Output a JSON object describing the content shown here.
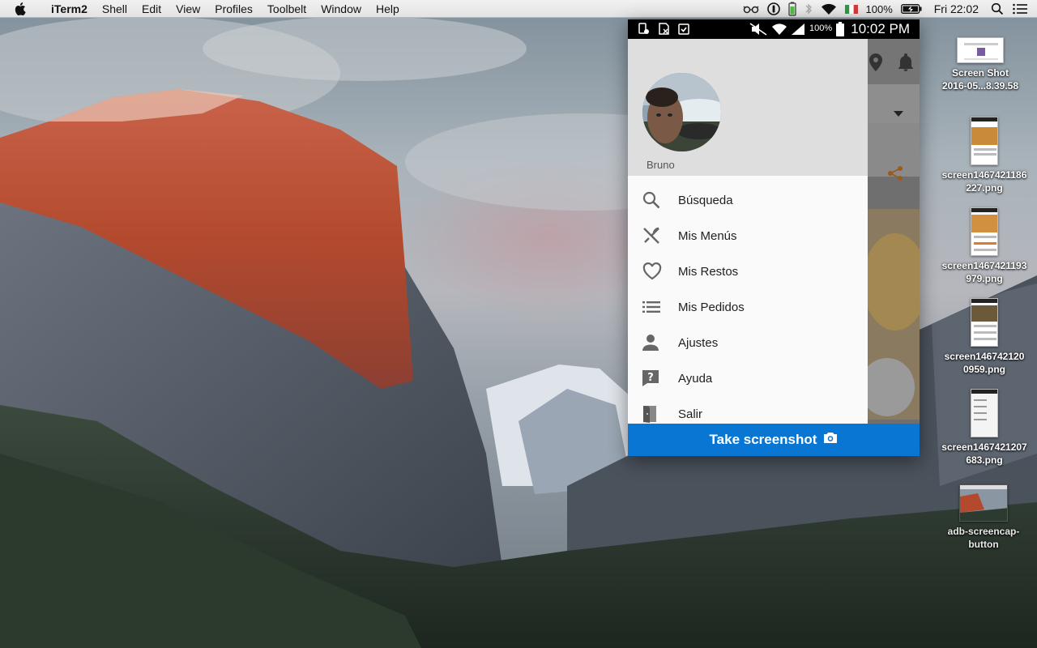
{
  "menubar": {
    "app_name": "iTerm2",
    "items": [
      "Shell",
      "Edit",
      "View",
      "Profiles",
      "Toolbelt",
      "Window",
      "Help"
    ],
    "battery": "100%",
    "clock": "Fri 22:02"
  },
  "phone": {
    "status_bar": {
      "battery": "100%",
      "time": "10:02 PM"
    },
    "drawer": {
      "user_name": "Bruno",
      "items": [
        {
          "label": "Búsqueda",
          "icon": "search-icon"
        },
        {
          "label": "Mis Menús",
          "icon": "cutlery-icon"
        },
        {
          "label": "Mis Restos",
          "icon": "heart-icon"
        },
        {
          "label": "Mis Pedidos",
          "icon": "list-icon"
        },
        {
          "label": "Ajustes",
          "icon": "person-icon"
        },
        {
          "label": "Ayuda",
          "icon": "help-icon"
        },
        {
          "label": "Salir",
          "icon": "exit-door-icon"
        }
      ]
    },
    "take_screenshot_label": "Take screenshot"
  },
  "desktop_icons": [
    {
      "line1": "Screen Shot",
      "line2": "2016-05...8.39.58"
    },
    {
      "line1": "screen1467421186",
      "line2": "227.png"
    },
    {
      "line1": "screen1467421193",
      "line2": "979.png"
    },
    {
      "line1": "screen146742120",
      "line2": "0959.png"
    },
    {
      "line1": "screen1467421207",
      "line2": "683.png"
    },
    {
      "line1": "adb-screencap-",
      "line2": "button"
    }
  ],
  "colors": {
    "accent_button": "#0a76d4",
    "drawer_header": "#dedede"
  }
}
